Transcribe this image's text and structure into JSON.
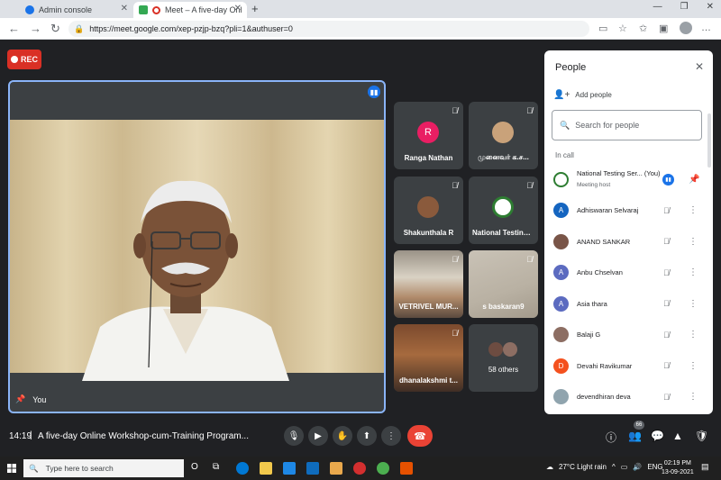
{
  "browser": {
    "tabs": [
      {
        "title": "Admin console",
        "icon": "google-admin-icon"
      },
      {
        "title": "Meet – A five-day Online Wo",
        "icon": "google-meet-icon",
        "active": true
      }
    ],
    "url": "https://meet.google.com/xep-pzjp-bzq?pli=1&authuser=0"
  },
  "meet": {
    "rec_label": "REC",
    "main_speaker_name": "You",
    "tiles": [
      {
        "name": "Ranga Nathan",
        "avatar_letter": "R",
        "avatar_color": "#e91e63"
      },
      {
        "name": "முனைவர் க.ச...",
        "avatar_kind": "photo"
      },
      {
        "name": "Shakunthala R",
        "avatar_kind": "photo"
      },
      {
        "name": "National Testing ...",
        "avatar_kind": "logo"
      },
      {
        "name": "VETRIVEL MUR...",
        "avatar_kind": "video"
      },
      {
        "name": "s baskaran9",
        "avatar_kind": "video"
      },
      {
        "name": "dhanalakshmi t...",
        "avatar_kind": "video"
      },
      {
        "name": "58 others",
        "avatar_kind": "group"
      }
    ],
    "time": "14:19",
    "title": "A five-day Online Workshop-cum-Training Program...",
    "people_count": "66"
  },
  "people_panel": {
    "title": "People",
    "add_people": "Add people",
    "search_placeholder": "Search for people",
    "in_call_label": "In call",
    "participants": [
      {
        "name": "National Testing Ser...  (You)",
        "sub": "Meeting host",
        "avatar_color": "#ffffff",
        "avatar_letter": ""
      },
      {
        "name": "Adhiswaran Selvaraj",
        "avatar_color": "#1565c0",
        "avatar_letter": "A"
      },
      {
        "name": "ANAND SANKAR",
        "avatar_color": "#795548",
        "avatar_letter": ""
      },
      {
        "name": "Anbu Chselvan",
        "avatar_color": "#5c6bc0",
        "avatar_letter": "A"
      },
      {
        "name": "Asia thara",
        "avatar_color": "#5c6bc0",
        "avatar_letter": "A"
      },
      {
        "name": "Balaji G",
        "avatar_color": "#8d6e63",
        "avatar_letter": ""
      },
      {
        "name": "Devahi Ravikumar",
        "avatar_color": "#f4511e",
        "avatar_letter": "D"
      },
      {
        "name": "devendhiran deva",
        "avatar_color": "#90a4ae",
        "avatar_letter": ""
      }
    ]
  },
  "taskbar": {
    "search_placeholder": "Type here to search",
    "weather": "27°C  Light rain",
    "lang": "ENG",
    "clock_time": "02:19 PM",
    "clock_date": "13-09-2021"
  }
}
